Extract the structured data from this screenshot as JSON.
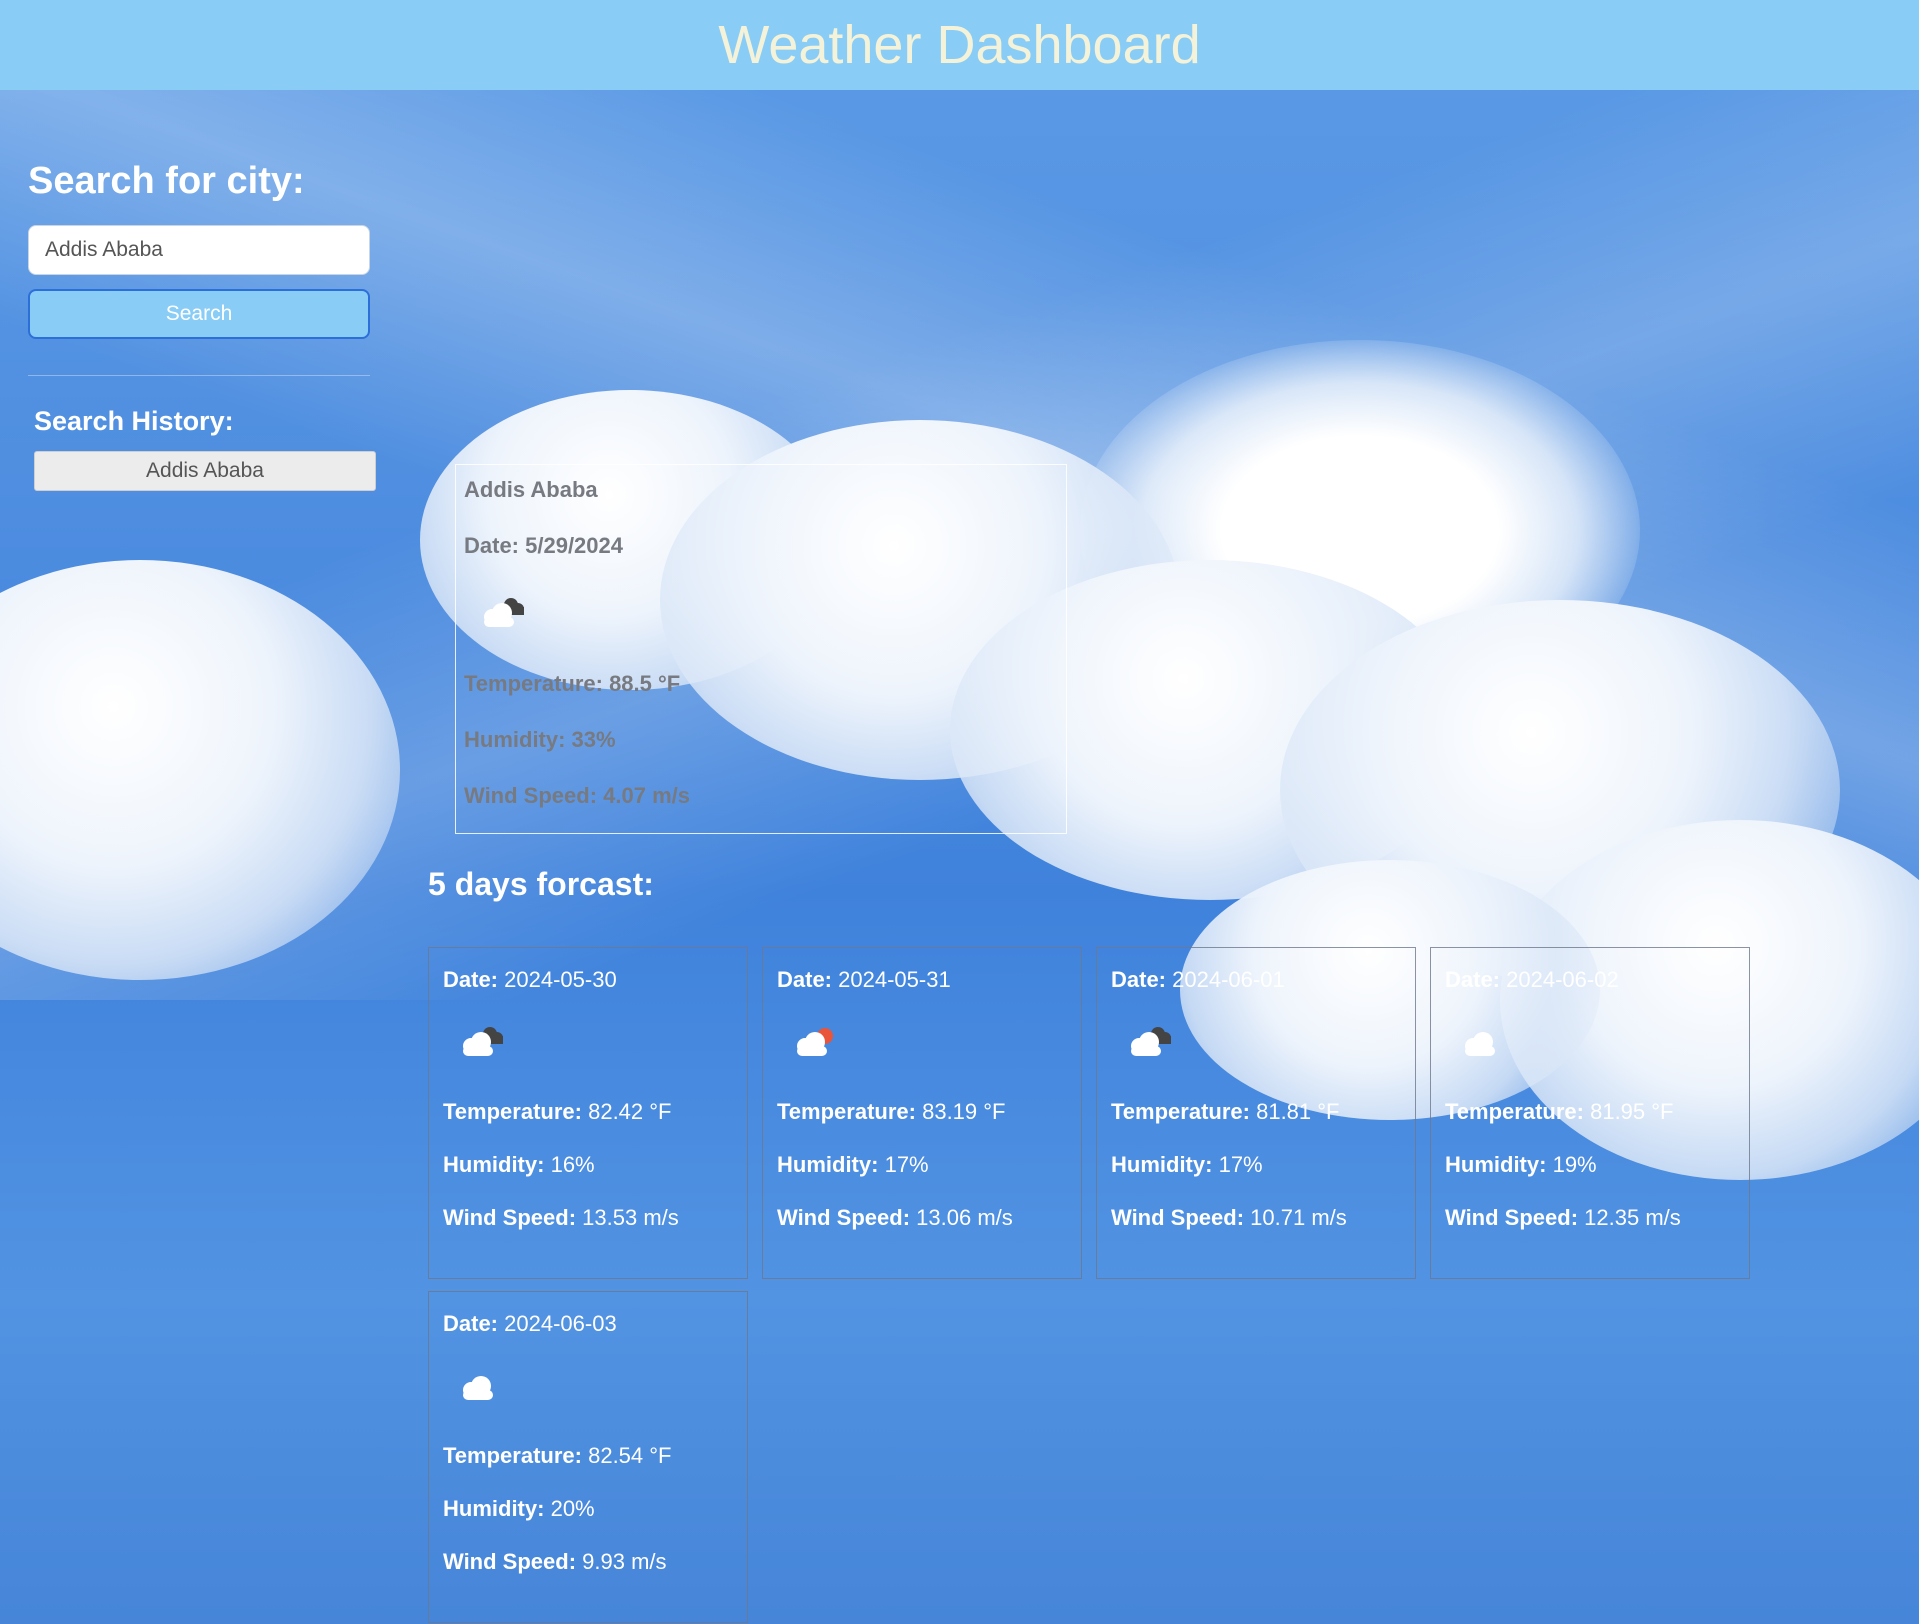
{
  "header": {
    "title": "Weather Dashboard"
  },
  "sidebar": {
    "search_title": "Search for city:",
    "search_value": "Addis Ababa",
    "search_button": "Search",
    "history_title": "Search History:",
    "history": [
      "Addis Ababa"
    ]
  },
  "current": {
    "city": "Addis Ababa",
    "date": "Date: 5/29/2024",
    "icon": "cloud-dark-icon",
    "temperature": "Temperature: 88.5 °F",
    "humidity": "Humidity: 33%",
    "wind": "Wind Speed: 4.07 m/s"
  },
  "forecast": {
    "title": "5 days forcast:",
    "labels": {
      "date": "Date:",
      "temperature": "Temperature:",
      "humidity": "Humidity:",
      "wind": "Wind Speed:"
    },
    "days": [
      {
        "date": "2024-05-30",
        "icon": "cloud-dark-icon",
        "temperature": "82.42 °F",
        "humidity": "16%",
        "wind": "13.53 m/s"
      },
      {
        "date": "2024-05-31",
        "icon": "cloud-sun-icon",
        "temperature": "83.19 °F",
        "humidity": "17%",
        "wind": "13.06 m/s"
      },
      {
        "date": "2024-06-01",
        "icon": "cloud-dark-icon",
        "temperature": "81.81 °F",
        "humidity": "17%",
        "wind": "10.71 m/s"
      },
      {
        "date": "2024-06-02",
        "icon": "cloud-icon",
        "temperature": "81.95 °F",
        "humidity": "19%",
        "wind": "12.35 m/s"
      },
      {
        "date": "2024-06-03",
        "icon": "cloud-icon",
        "temperature": "82.54 °F",
        "humidity": "20%",
        "wind": "9.93 m/s"
      }
    ]
  }
}
